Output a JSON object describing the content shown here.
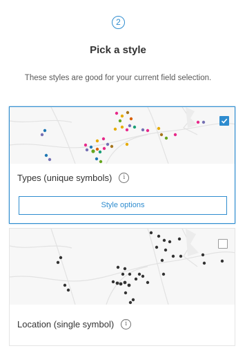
{
  "step": {
    "number": "2"
  },
  "header": {
    "title": "Pick a style",
    "description": "These styles are good for your current field selection."
  },
  "styles": [
    {
      "label": "Types (unique symbols)",
      "selected": true,
      "options_button": "Style options",
      "accent": "#2e8ccf"
    },
    {
      "label": "Location (single symbol)",
      "selected": false
    }
  ],
  "colors": {
    "accent": "#2e8ccf",
    "point_single": "#333333"
  }
}
